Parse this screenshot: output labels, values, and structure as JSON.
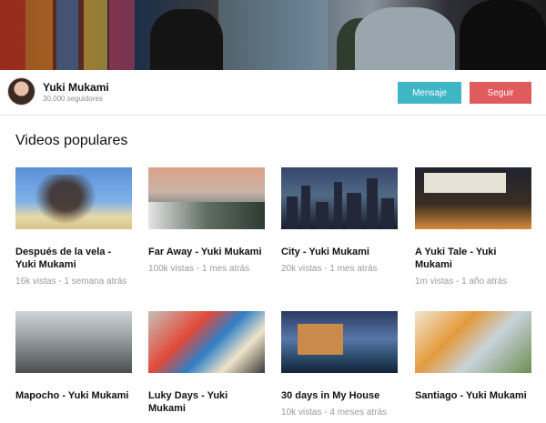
{
  "profile": {
    "name": "Yuki Mukami",
    "followers": "30.000 seguidores",
    "message_label": "Mensaje",
    "follow_label": "Seguir"
  },
  "section": {
    "title": "Videos populares"
  },
  "videos": [
    {
      "title": "Después de la vela - Yuki Mukami",
      "meta": "16k vistas - 1 semana atrás",
      "thumb_icon": "bare-tree-thumbnail"
    },
    {
      "title": "Far Away - Yuki Mukami",
      "meta": "100k vistas - 1 mes atrás",
      "thumb_icon": "mountain-forest-thumbnail"
    },
    {
      "title": "City - Yuki Mukami",
      "meta": "20k vistas - 1 mes atrás",
      "thumb_icon": "city-skyline-thumbnail"
    },
    {
      "title": "A Yuki Tale - Yuki Mukami",
      "meta": "1m vistas - 1 año atrás",
      "thumb_icon": "japanese-street-thumbnail"
    },
    {
      "title": "Mapocho - Yuki Mukami",
      "meta": "",
      "thumb_icon": "street-crowd-thumbnail"
    },
    {
      "title": "Luky Days - Yuki Mukami",
      "meta": "",
      "thumb_icon": "magazines-thumbnail"
    },
    {
      "title": "30 days in My House",
      "meta": "10k vistas - 4 meses atrás",
      "thumb_icon": "lake-house-thumbnail"
    },
    {
      "title": "Santiago - Yuki Mukami",
      "meta": "",
      "thumb_icon": "autumn-leaves-thumbnail"
    }
  ]
}
